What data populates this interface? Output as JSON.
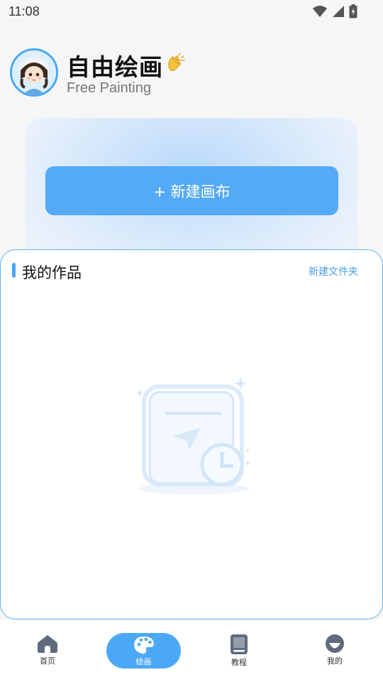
{
  "status_bar": {
    "time": "11:08"
  },
  "header": {
    "title": "自由绘画",
    "subtitle": "Free Painting",
    "emoji_icon": "clapping-hands-icon"
  },
  "card": {
    "new_canvas_label": "+ 新建画布"
  },
  "works": {
    "title": "我的作品",
    "new_folder_label": "新建文件夹"
  },
  "nav": {
    "items": [
      {
        "label": "首页",
        "icon": "home-icon"
      },
      {
        "label": "绘画",
        "icon": "palette-icon",
        "active": true
      },
      {
        "label": "教程",
        "icon": "book-icon"
      },
      {
        "label": "我的",
        "icon": "profile-icon"
      }
    ]
  },
  "colors": {
    "accent": "#4ba8f6",
    "panel_border": "#5cb0ee",
    "nav_icon": "#5f6b7d"
  }
}
